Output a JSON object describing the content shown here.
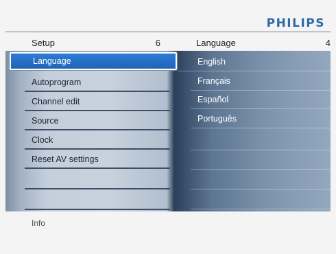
{
  "brand": {
    "logo_text": "PHILIPS"
  },
  "left_menu": {
    "title": "Setup",
    "count": "6",
    "items": [
      {
        "label": "Language",
        "selected": true
      },
      {
        "label": "Autoprogram"
      },
      {
        "label": "Channel edit"
      },
      {
        "label": "Source"
      },
      {
        "label": "Clock"
      },
      {
        "label": "Reset AV settings"
      },
      {
        "label": ""
      },
      {
        "label": ""
      }
    ]
  },
  "right_menu": {
    "title": "Language",
    "count": "4",
    "items": [
      {
        "label": "English"
      },
      {
        "label": "Français"
      },
      {
        "label": "Español"
      },
      {
        "label": "Português"
      },
      {
        "label": ""
      },
      {
        "label": ""
      },
      {
        "label": ""
      },
      {
        "label": ""
      }
    ]
  },
  "footer": {
    "info_label": "Info"
  },
  "colors": {
    "brand_blue": "#2f69a8",
    "selection_blue": "#1f63b7",
    "panel_dark": "#2c3f5a"
  }
}
